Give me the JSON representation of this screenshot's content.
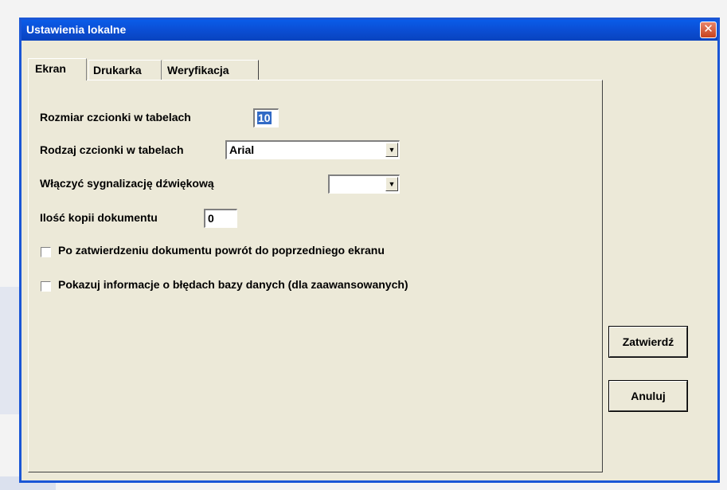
{
  "window": {
    "title": "Ustawienia lokalne"
  },
  "tabs": [
    {
      "label": "Ekran"
    },
    {
      "label": "Drukarka"
    },
    {
      "label": "Weryfikacja"
    }
  ],
  "ekran": {
    "font_size_label": "Rozmiar czcionki w tabelach",
    "font_size_value": "10",
    "font_type_label": "Rodzaj czcionki w tabelach",
    "font_type_value": "Arial",
    "sound_label": "Włączyć sygnalizację dźwiękową",
    "sound_value": "",
    "copies_label": "Ilość kopii dokumentu",
    "copies_value": "0",
    "return_label": "Po zatwierdzeniu dokumentu powrót do poprzedniego ekranu",
    "return_checked": false,
    "errors_label": "Pokazuj informacje o błędach bazy danych (dla zaawansowanych)",
    "errors_checked": false
  },
  "buttons": {
    "confirm": "Zatwierdź",
    "cancel": "Anuluj"
  },
  "colors": {
    "titlebar": "#0b4fd6",
    "window_bg": "#ece9d8",
    "selection": "#316ac5",
    "close_button": "#c8421d"
  }
}
